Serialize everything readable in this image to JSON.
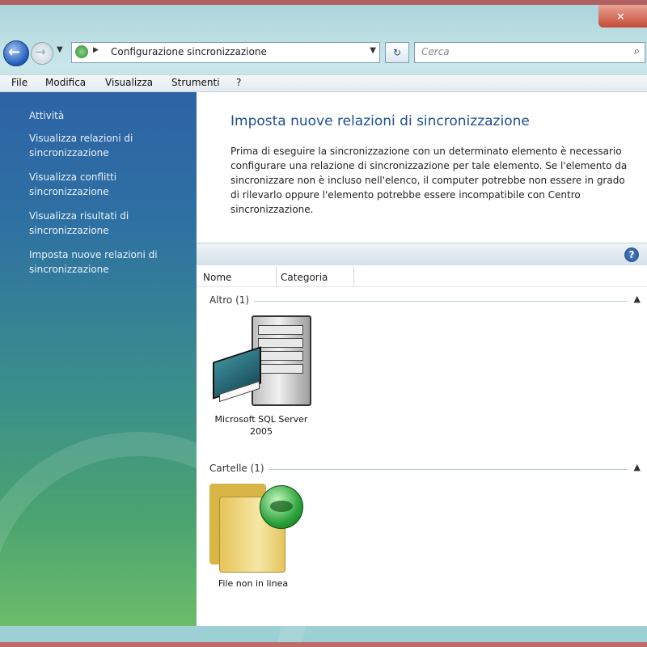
{
  "window": {
    "close_glyph": "✕"
  },
  "address_bar": {
    "path": "Configurazione sincronizzazione",
    "search_placeholder": "Cerca"
  },
  "menu": [
    "File",
    "Modifica",
    "Visualizza",
    "Strumenti",
    "?"
  ],
  "sidebar": {
    "items": [
      {
        "label": "Attività"
      },
      {
        "label": "Visualizza relazioni di sincronizzazione"
      },
      {
        "label": "Visualizza conflitti sincronizzazione"
      },
      {
        "label": "Visualizza risultati di sincronizzazione"
      },
      {
        "label": "Imposta nuove relazioni di sincronizzazione"
      }
    ]
  },
  "main": {
    "title": "Imposta nuove relazioni di sincronizzazione",
    "description": "Prima di eseguire la sincronizzazione con un determinato elemento è necessario configurare una relazione di sincronizzazione per tale elemento. Se l'elemento da sincronizzare non è incluso nell'elenco, il computer potrebbe non essere in grado di rilevarlo oppure l'elemento potrebbe essere incompatibile con Centro sincronizzazione.",
    "help_glyph": "?",
    "columns": [
      "Nome",
      "Categoria"
    ],
    "groups": [
      {
        "label": "Altro (1)",
        "items": [
          {
            "label": "Microsoft SQL Server 2005",
            "icon": "sql-server-icon"
          }
        ]
      },
      {
        "label": "Cartelle (1)",
        "items": [
          {
            "label": "File non in linea",
            "icon": "offline-files-folder-icon"
          }
        ]
      }
    ]
  }
}
